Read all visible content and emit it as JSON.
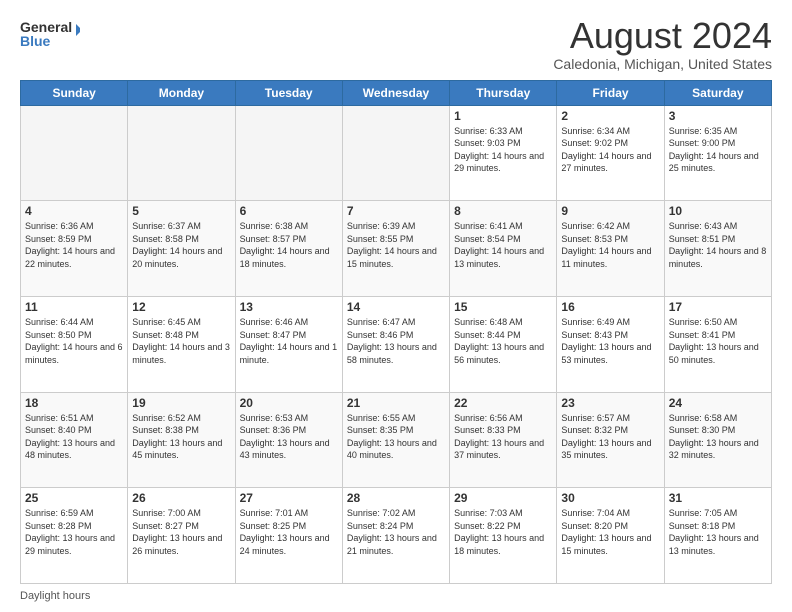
{
  "header": {
    "logo_line1": "General",
    "logo_line2": "Blue",
    "month_title": "August 2024",
    "location": "Caledonia, Michigan, United States"
  },
  "days_of_week": [
    "Sunday",
    "Monday",
    "Tuesday",
    "Wednesday",
    "Thursday",
    "Friday",
    "Saturday"
  ],
  "weeks": [
    [
      {
        "day": "",
        "info": ""
      },
      {
        "day": "",
        "info": ""
      },
      {
        "day": "",
        "info": ""
      },
      {
        "day": "",
        "info": ""
      },
      {
        "day": "1",
        "info": "Sunrise: 6:33 AM\nSunset: 9:03 PM\nDaylight: 14 hours and 29 minutes."
      },
      {
        "day": "2",
        "info": "Sunrise: 6:34 AM\nSunset: 9:02 PM\nDaylight: 14 hours and 27 minutes."
      },
      {
        "day": "3",
        "info": "Sunrise: 6:35 AM\nSunset: 9:00 PM\nDaylight: 14 hours and 25 minutes."
      }
    ],
    [
      {
        "day": "4",
        "info": "Sunrise: 6:36 AM\nSunset: 8:59 PM\nDaylight: 14 hours and 22 minutes."
      },
      {
        "day": "5",
        "info": "Sunrise: 6:37 AM\nSunset: 8:58 PM\nDaylight: 14 hours and 20 minutes."
      },
      {
        "day": "6",
        "info": "Sunrise: 6:38 AM\nSunset: 8:57 PM\nDaylight: 14 hours and 18 minutes."
      },
      {
        "day": "7",
        "info": "Sunrise: 6:39 AM\nSunset: 8:55 PM\nDaylight: 14 hours and 15 minutes."
      },
      {
        "day": "8",
        "info": "Sunrise: 6:41 AM\nSunset: 8:54 PM\nDaylight: 14 hours and 13 minutes."
      },
      {
        "day": "9",
        "info": "Sunrise: 6:42 AM\nSunset: 8:53 PM\nDaylight: 14 hours and 11 minutes."
      },
      {
        "day": "10",
        "info": "Sunrise: 6:43 AM\nSunset: 8:51 PM\nDaylight: 14 hours and 8 minutes."
      }
    ],
    [
      {
        "day": "11",
        "info": "Sunrise: 6:44 AM\nSunset: 8:50 PM\nDaylight: 14 hours and 6 minutes."
      },
      {
        "day": "12",
        "info": "Sunrise: 6:45 AM\nSunset: 8:48 PM\nDaylight: 14 hours and 3 minutes."
      },
      {
        "day": "13",
        "info": "Sunrise: 6:46 AM\nSunset: 8:47 PM\nDaylight: 14 hours and 1 minute."
      },
      {
        "day": "14",
        "info": "Sunrise: 6:47 AM\nSunset: 8:46 PM\nDaylight: 13 hours and 58 minutes."
      },
      {
        "day": "15",
        "info": "Sunrise: 6:48 AM\nSunset: 8:44 PM\nDaylight: 13 hours and 56 minutes."
      },
      {
        "day": "16",
        "info": "Sunrise: 6:49 AM\nSunset: 8:43 PM\nDaylight: 13 hours and 53 minutes."
      },
      {
        "day": "17",
        "info": "Sunrise: 6:50 AM\nSunset: 8:41 PM\nDaylight: 13 hours and 50 minutes."
      }
    ],
    [
      {
        "day": "18",
        "info": "Sunrise: 6:51 AM\nSunset: 8:40 PM\nDaylight: 13 hours and 48 minutes."
      },
      {
        "day": "19",
        "info": "Sunrise: 6:52 AM\nSunset: 8:38 PM\nDaylight: 13 hours and 45 minutes."
      },
      {
        "day": "20",
        "info": "Sunrise: 6:53 AM\nSunset: 8:36 PM\nDaylight: 13 hours and 43 minutes."
      },
      {
        "day": "21",
        "info": "Sunrise: 6:55 AM\nSunset: 8:35 PM\nDaylight: 13 hours and 40 minutes."
      },
      {
        "day": "22",
        "info": "Sunrise: 6:56 AM\nSunset: 8:33 PM\nDaylight: 13 hours and 37 minutes."
      },
      {
        "day": "23",
        "info": "Sunrise: 6:57 AM\nSunset: 8:32 PM\nDaylight: 13 hours and 35 minutes."
      },
      {
        "day": "24",
        "info": "Sunrise: 6:58 AM\nSunset: 8:30 PM\nDaylight: 13 hours and 32 minutes."
      }
    ],
    [
      {
        "day": "25",
        "info": "Sunrise: 6:59 AM\nSunset: 8:28 PM\nDaylight: 13 hours and 29 minutes."
      },
      {
        "day": "26",
        "info": "Sunrise: 7:00 AM\nSunset: 8:27 PM\nDaylight: 13 hours and 26 minutes."
      },
      {
        "day": "27",
        "info": "Sunrise: 7:01 AM\nSunset: 8:25 PM\nDaylight: 13 hours and 24 minutes."
      },
      {
        "day": "28",
        "info": "Sunrise: 7:02 AM\nSunset: 8:24 PM\nDaylight: 13 hours and 21 minutes."
      },
      {
        "day": "29",
        "info": "Sunrise: 7:03 AM\nSunset: 8:22 PM\nDaylight: 13 hours and 18 minutes."
      },
      {
        "day": "30",
        "info": "Sunrise: 7:04 AM\nSunset: 8:20 PM\nDaylight: 13 hours and 15 minutes."
      },
      {
        "day": "31",
        "info": "Sunrise: 7:05 AM\nSunset: 8:18 PM\nDaylight: 13 hours and 13 minutes."
      }
    ]
  ],
  "footer": {
    "daylight_label": "Daylight hours"
  }
}
